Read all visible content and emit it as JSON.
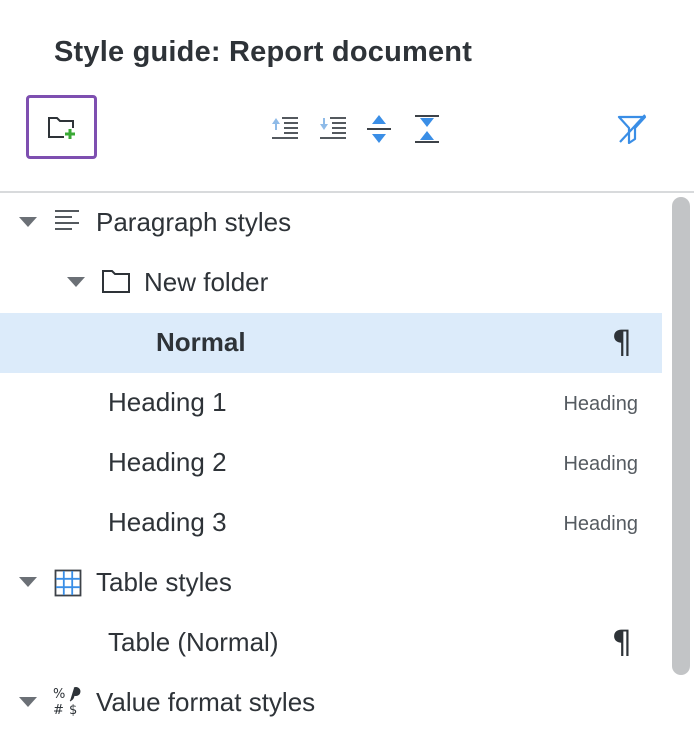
{
  "panel": {
    "title": "Style guide: Report document"
  },
  "toolbar": {
    "new_folder": {
      "icon": "folder-plus-icon"
    },
    "move_up": {
      "icon": "indent-up-icon"
    },
    "move_down": {
      "icon": "indent-down-icon"
    },
    "expand_all": {
      "icon": "expand-all-icon"
    },
    "collapse_all": {
      "icon": "collapse-all-icon"
    },
    "filter": {
      "icon": "filter-icon"
    }
  },
  "tree": {
    "paragraph_styles": {
      "label": "Paragraph styles",
      "icon": "paragraph-lines-icon"
    },
    "new_folder": {
      "label": "New folder",
      "icon": "folder-icon"
    },
    "normal": {
      "label": "Normal",
      "tag": "¶"
    },
    "heading1": {
      "label": "Heading 1",
      "tag": "Heading"
    },
    "heading2": {
      "label": "Heading 2",
      "tag": "Heading"
    },
    "heading3": {
      "label": "Heading 3",
      "tag": "Heading"
    },
    "table_styles": {
      "label": "Table styles",
      "icon": "table-grid-icon"
    },
    "table_normal": {
      "label": "Table (Normal)",
      "tag": "¶"
    },
    "value_format_styles": {
      "label": "Value format styles",
      "icon": "value-format-icon"
    }
  },
  "colors": {
    "selection": "#dcebfa",
    "accent_blue": "#3a8ee6",
    "focus_purple": "#7e4fb0",
    "add_green": "#3aa935"
  }
}
